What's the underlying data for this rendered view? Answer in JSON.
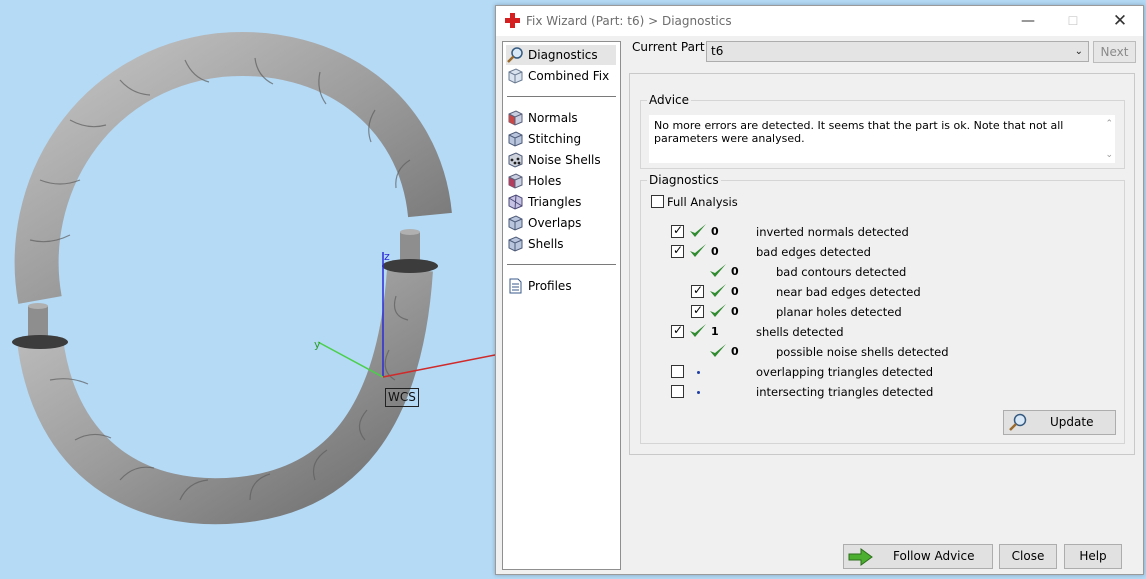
{
  "viewport": {
    "wcs_label": "WCS",
    "axis_z": "z",
    "axis_y": "y",
    "model_color": "#9a9a9a"
  },
  "window": {
    "title": "Fix Wizard (Part: t6) > Diagnostics",
    "icon": "red-cross-icon",
    "min_symbol": "—",
    "max_symbol": "☐",
    "close_symbol": "✕"
  },
  "nav": {
    "items": [
      {
        "label": "Diagnostics",
        "icon": "magnifier-icon",
        "selected": true
      },
      {
        "label": "Combined Fix",
        "icon": "cube-icon"
      },
      {
        "label": "Normals",
        "icon": "cube-red-icon"
      },
      {
        "label": "Stitching",
        "icon": "cube-blue-icon"
      },
      {
        "label": "Noise Shells",
        "icon": "dots-cube-icon"
      },
      {
        "label": "Holes",
        "icon": "cube-red-icon"
      },
      {
        "label": "Triangles",
        "icon": "triangle-cube-icon"
      },
      {
        "label": "Overlaps",
        "icon": "cube-blue-icon"
      },
      {
        "label": "Shells",
        "icon": "cube-blue-icon"
      },
      {
        "label": "Profiles",
        "icon": "document-icon"
      }
    ]
  },
  "header": {
    "current_part_label": "Current Part:",
    "current_part_value": "t6",
    "next_label": "Next"
  },
  "advice": {
    "title": "Advice",
    "text": "No more errors are detected. It seems that the part is ok. Note that not all parameters were analysed."
  },
  "diagnostics": {
    "title": "Diagnostics",
    "full_analysis_label": "Full Analysis",
    "full_analysis_checked": false,
    "rows": [
      {
        "checkbox": true,
        "checked": true,
        "status": "ok",
        "count": "0",
        "label": "inverted normals detected",
        "indent": 0
      },
      {
        "checkbox": true,
        "checked": true,
        "status": "ok",
        "count": "0",
        "label": "bad edges detected",
        "indent": 0
      },
      {
        "checkbox": false,
        "checked": false,
        "status": "ok",
        "count": "0",
        "label": "bad contours detected",
        "indent": 1
      },
      {
        "checkbox": true,
        "checked": true,
        "status": "ok",
        "count": "0",
        "label": "near bad edges detected",
        "indent": 1
      },
      {
        "checkbox": true,
        "checked": true,
        "status": "ok",
        "count": "0",
        "label": "planar holes detected",
        "indent": 1
      },
      {
        "checkbox": true,
        "checked": true,
        "status": "ok",
        "count": "1",
        "label": "shells detected",
        "indent": 0
      },
      {
        "checkbox": false,
        "checked": false,
        "status": "ok",
        "count": "0",
        "label": "possible noise shells detected",
        "indent": 1
      },
      {
        "checkbox": true,
        "checked": false,
        "status": "pending",
        "count": "",
        "label": "overlapping triangles detected",
        "indent": 0
      },
      {
        "checkbox": true,
        "checked": false,
        "status": "pending",
        "count": "",
        "label": "intersecting triangles detected",
        "indent": 0
      }
    ],
    "update_label": "Update"
  },
  "footer": {
    "follow_advice_label": "Follow Advice",
    "close_label": "Close",
    "help_label": "Help"
  },
  "colors": {
    "check_green": "#2e8b2e",
    "pending_dot": "#1f3fa7",
    "title_cross": "#d42020"
  }
}
